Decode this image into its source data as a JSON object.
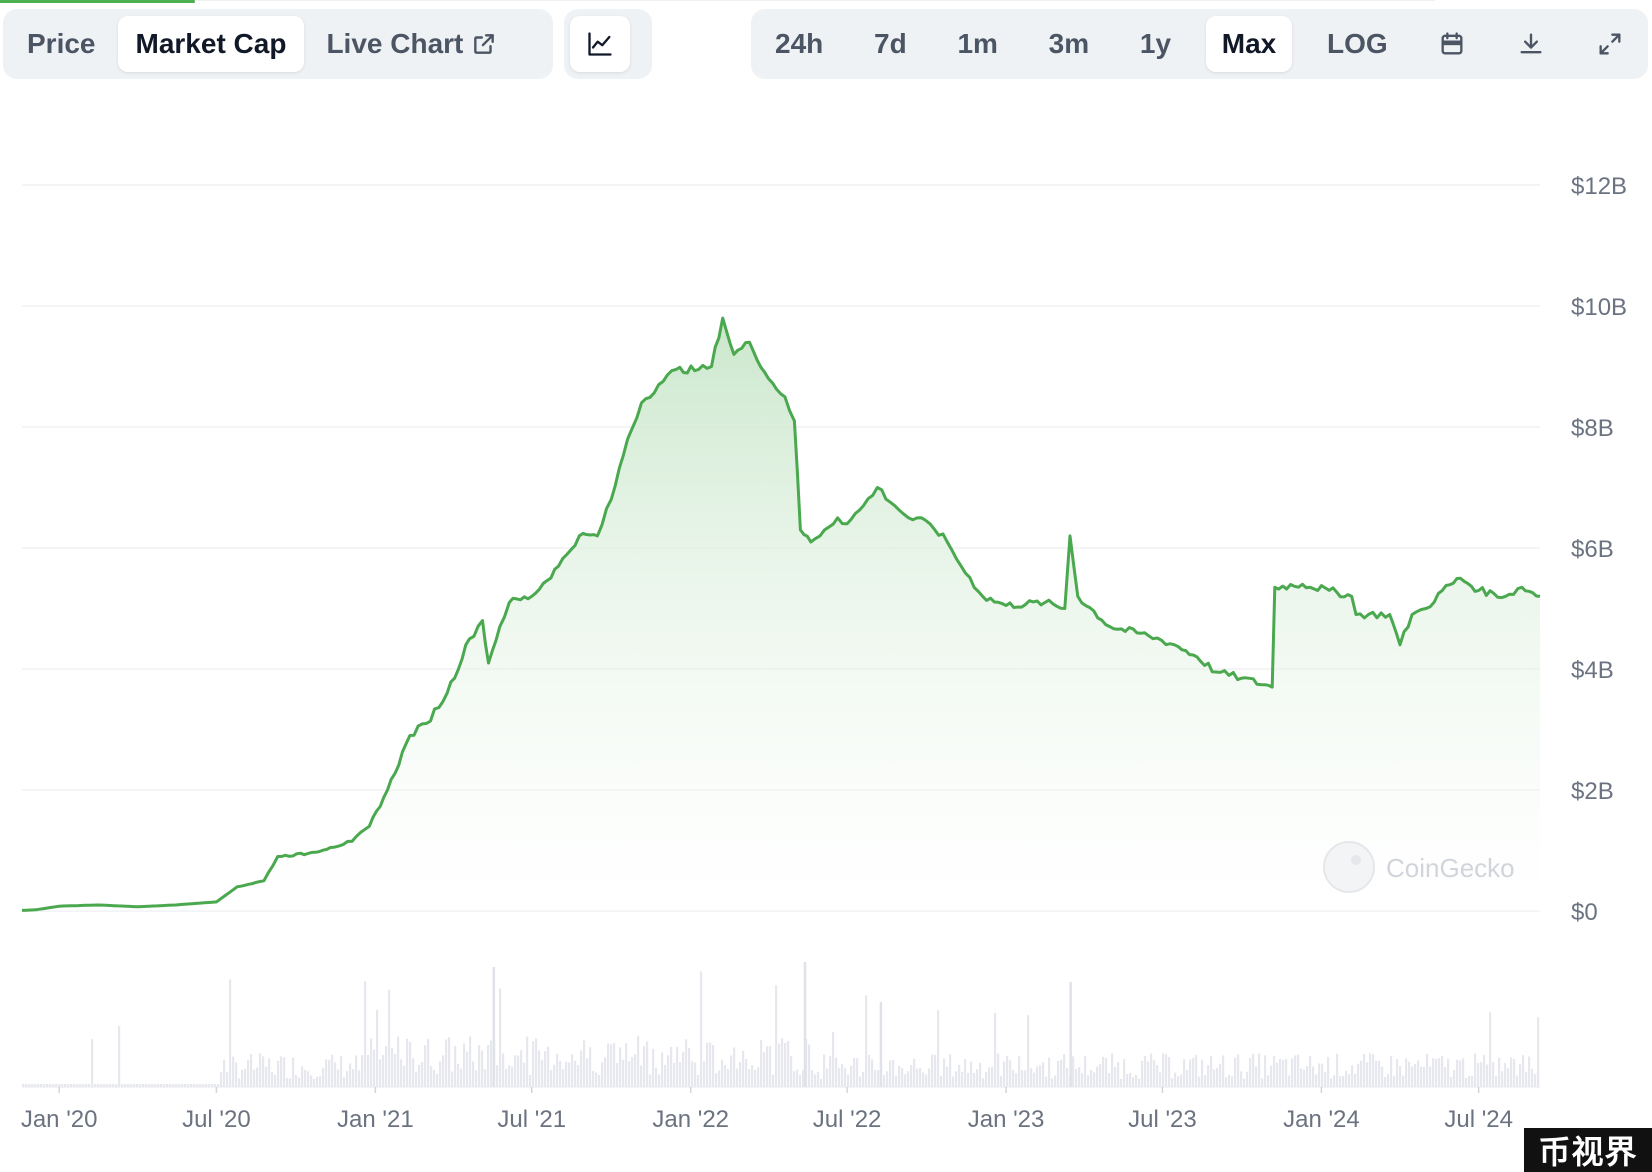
{
  "tabs": {
    "price": "Price",
    "market_cap": "Market Cap",
    "live_chart": "Live Chart",
    "active": "Market Cap"
  },
  "chart_toggle": {
    "icon": "line-chart-icon"
  },
  "ranges": {
    "items": [
      "24h",
      "7d",
      "1m",
      "3m",
      "1y",
      "Max"
    ],
    "active": "Max",
    "log_label": "LOG"
  },
  "tools": {
    "calendar_icon": "calendar-icon",
    "download_icon": "download-icon",
    "expand_icon": "expand-icon"
  },
  "brand": {
    "logo_text": "CoinGecko",
    "watermark_text": "币视界"
  },
  "colors": {
    "line": "#4aa84e",
    "fill_top": "#cfe8cf",
    "grid": "#eef0f3",
    "volume": "#e6e8ee",
    "axis_text": "#6b7280"
  },
  "chart_data": {
    "type": "area",
    "title": "",
    "xlabel": "",
    "ylabel": "",
    "grid": true,
    "ylim": [
      0,
      12
    ],
    "y_unit": "B",
    "y_ticks": [
      "$0",
      "$2B",
      "$4B",
      "$6B",
      "$8B",
      "$10B",
      "$12B"
    ],
    "y_tick_values": [
      0,
      2,
      4,
      6,
      8,
      10,
      12
    ],
    "xlim": [
      "2019-11-19",
      "2024-09-10"
    ],
    "x_ticks": [
      "Jan '20",
      "Jul '20",
      "Jan '21",
      "Jul '21",
      "Jan '22",
      "Jul '22",
      "Jan '23",
      "Jul '23",
      "Jan '24",
      "Jul '24"
    ],
    "x_tick_dates": [
      "2020-01-01",
      "2020-07-01",
      "2021-01-01",
      "2021-07-01",
      "2022-01-01",
      "2022-07-01",
      "2023-01-01",
      "2023-07-01",
      "2024-01-01",
      "2024-07-01"
    ],
    "series": [
      {
        "values_unit": "USD billions",
        "points": [
          [
            "2019-11-19",
            0.01
          ],
          [
            "2019-12-05",
            0.02
          ],
          [
            "2020-01-01",
            0.08
          ],
          [
            "2020-02-15",
            0.1
          ],
          [
            "2020-04-01",
            0.07
          ],
          [
            "2020-05-15",
            0.1
          ],
          [
            "2020-07-01",
            0.15
          ],
          [
            "2020-07-25",
            0.4
          ],
          [
            "2020-08-25",
            0.5
          ],
          [
            "2020-09-10",
            0.9
          ],
          [
            "2020-10-15",
            0.95
          ],
          [
            "2020-11-10",
            1.05
          ],
          [
            "2020-12-05",
            1.15
          ],
          [
            "2020-12-25",
            1.4
          ],
          [
            "2021-01-15",
            2.0
          ],
          [
            "2021-02-10",
            2.9
          ],
          [
            "2021-03-01",
            3.1
          ],
          [
            "2021-03-25",
            3.6
          ],
          [
            "2021-04-20",
            4.5
          ],
          [
            "2021-05-05",
            4.8
          ],
          [
            "2021-05-12",
            4.1
          ],
          [
            "2021-05-25",
            4.7
          ],
          [
            "2021-06-05",
            5.1
          ],
          [
            "2021-07-01",
            5.2
          ],
          [
            "2021-08-01",
            5.7
          ],
          [
            "2021-08-25",
            6.2
          ],
          [
            "2021-09-15",
            6.2
          ],
          [
            "2021-10-01",
            6.8
          ],
          [
            "2021-10-20",
            7.8
          ],
          [
            "2021-11-05",
            8.4
          ],
          [
            "2021-11-25",
            8.7
          ],
          [
            "2021-12-15",
            8.95
          ],
          [
            "2022-01-10",
            8.95
          ],
          [
            "2022-01-25",
            9.0
          ],
          [
            "2022-02-07",
            9.8
          ],
          [
            "2022-02-20",
            9.2
          ],
          [
            "2022-03-10",
            9.4
          ],
          [
            "2022-04-01",
            8.8
          ],
          [
            "2022-04-20",
            8.5
          ],
          [
            "2022-05-01",
            8.1
          ],
          [
            "2022-05-08",
            6.3
          ],
          [
            "2022-05-20",
            6.1
          ],
          [
            "2022-06-05",
            6.3
          ],
          [
            "2022-06-20",
            6.5
          ],
          [
            "2022-07-01",
            6.4
          ],
          [
            "2022-07-20",
            6.7
          ],
          [
            "2022-08-05",
            7.0
          ],
          [
            "2022-08-25",
            6.7
          ],
          [
            "2022-09-10",
            6.5
          ],
          [
            "2022-10-05",
            6.4
          ],
          [
            "2022-10-25",
            6.1
          ],
          [
            "2022-11-10",
            5.7
          ],
          [
            "2022-12-05",
            5.2
          ],
          [
            "2023-01-01",
            5.05
          ],
          [
            "2023-02-15",
            5.1
          ],
          [
            "2023-03-10",
            5.0
          ],
          [
            "2023-03-16",
            6.2
          ],
          [
            "2023-03-25",
            5.2
          ],
          [
            "2023-05-01",
            4.7
          ],
          [
            "2023-06-15",
            4.55
          ],
          [
            "2023-07-15",
            4.4
          ],
          [
            "2023-08-10",
            4.2
          ],
          [
            "2023-09-01",
            3.95
          ],
          [
            "2023-10-01",
            3.85
          ],
          [
            "2023-11-05",
            3.7
          ],
          [
            "2023-11-08",
            5.35
          ],
          [
            "2023-12-10",
            5.4
          ],
          [
            "2024-01-10",
            5.3
          ],
          [
            "2024-02-05",
            5.2
          ],
          [
            "2024-02-10",
            4.9
          ],
          [
            "2024-03-20",
            4.9
          ],
          [
            "2024-04-01",
            4.4
          ],
          [
            "2024-04-15",
            4.9
          ],
          [
            "2024-05-01",
            5.0
          ],
          [
            "2024-05-20",
            5.3
          ],
          [
            "2024-06-10",
            5.5
          ],
          [
            "2024-07-01",
            5.3
          ],
          [
            "2024-08-01",
            5.2
          ],
          [
            "2024-08-20",
            5.35
          ],
          [
            "2024-09-10",
            5.2
          ]
        ]
      }
    ]
  }
}
